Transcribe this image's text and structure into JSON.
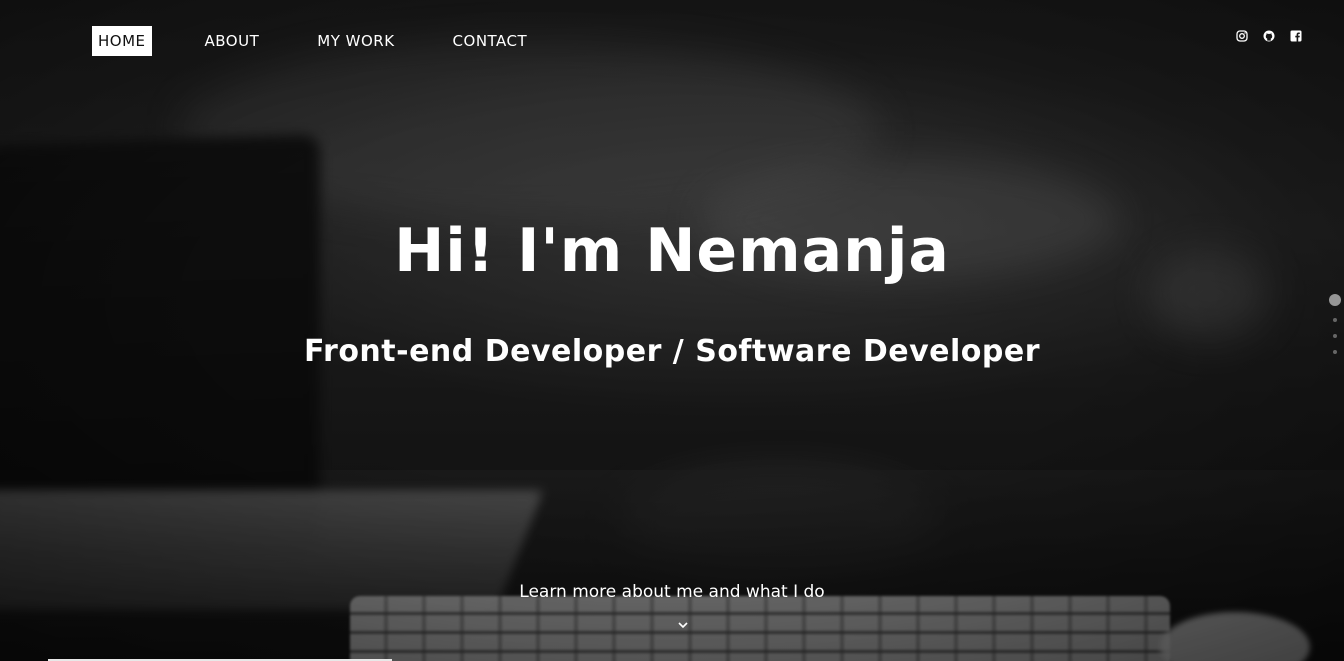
{
  "nav": {
    "items": [
      {
        "label": "HOME",
        "active": true
      },
      {
        "label": "ABOUT",
        "active": false
      },
      {
        "label": "MY WORK",
        "active": false
      },
      {
        "label": "CONTACT",
        "active": false
      }
    ]
  },
  "social": {
    "icons": [
      "instagram-icon",
      "github-icon",
      "facebook-icon"
    ]
  },
  "hero": {
    "title": "Hi! I'm Nemanja",
    "subtitle": "Front-end Developer / Software Developer",
    "cta": "Learn more about me and what I do"
  },
  "pagination": {
    "count": 4,
    "active_index": 0
  },
  "colors": {
    "text": "#ffffff",
    "active_nav_bg": "#ffffff",
    "active_nav_text": "#111111"
  }
}
